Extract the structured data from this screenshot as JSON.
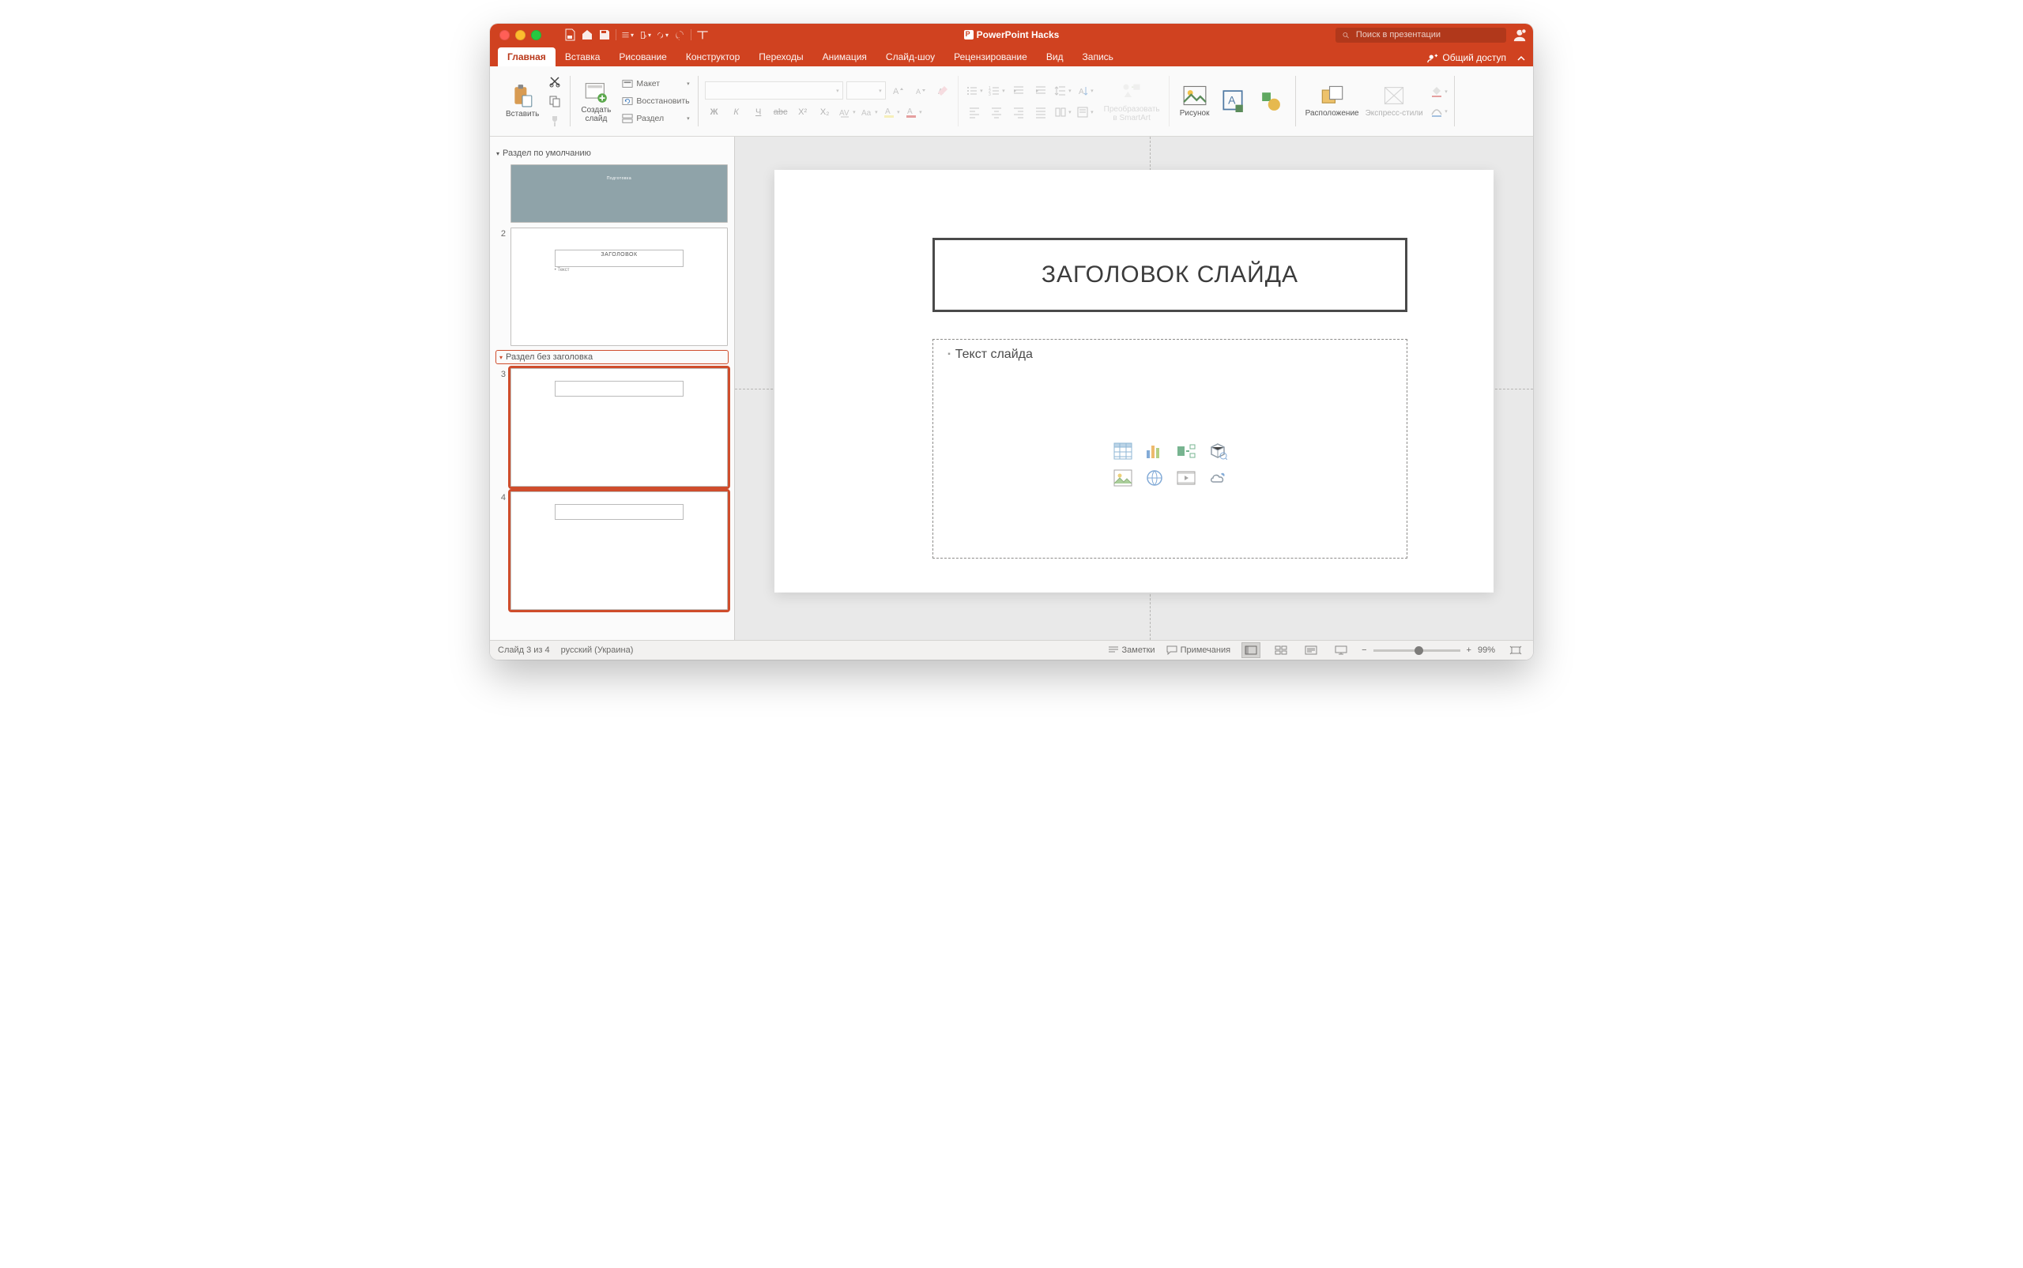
{
  "title": "PowerPoint Hacks",
  "search_placeholder": "Поиск в презентации",
  "share": "Общий доступ",
  "tabs": {
    "home": "Главная",
    "insert": "Вставка",
    "draw": "Рисование",
    "design": "Конструктор",
    "transitions": "Переходы",
    "animations": "Анимация",
    "slideshow": "Слайд-шоу",
    "review": "Рецензирование",
    "view": "Вид",
    "record": "Запись"
  },
  "ribbon": {
    "paste": "Вставить",
    "new_slide": "Создать\nслайд",
    "layout": "Макет",
    "reset": "Восстановить",
    "section": "Раздел",
    "convert_smartart": "Преобразовать\nв SmartArt",
    "picture": "Рисунок",
    "arrange": "Расположение",
    "quick_styles": "Экспресс-стили",
    "font_glyph_b": "Ж",
    "font_glyph_i": "К",
    "font_glyph_u": "Ч",
    "font_glyph_s": "abc",
    "font_sup": "X²",
    "font_sub": "X₂"
  },
  "sidebar": {
    "section1": "Раздел по умолчанию",
    "section2": "Раздел без заголовка",
    "thumbs": {
      "t1_cover_label": "Подготовка",
      "t2_num": "2",
      "t2_title": "ЗАГОЛОВОК",
      "t2_body": "Текст",
      "t3_num": "3",
      "t4_num": "4"
    }
  },
  "slide": {
    "title": "ЗАГОЛОВОК СЛАЙДА",
    "body": "Текст слайда"
  },
  "status": {
    "slide_n": "Слайд 3 из 4",
    "lang": "русский (Украина)",
    "notes": "Заметки",
    "comments": "Примечания",
    "zoom": "99%"
  }
}
